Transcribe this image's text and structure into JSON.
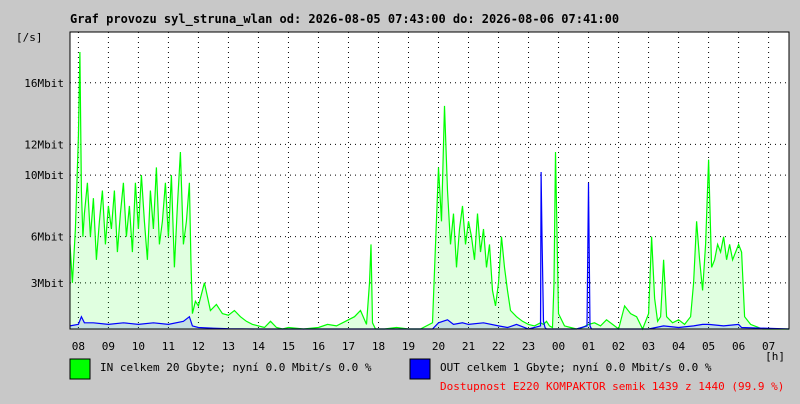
{
  "chart_data": {
    "type": "line",
    "title": "Graf provozu syl_struna_wlan od: 2026-08-05 07:43:00 do: 2026-08-06 07:41:00",
    "ylabel": "[/s]",
    "xlabel": "[h]",
    "grid": true,
    "ylim": [
      0,
      19.3
    ],
    "xlim": [
      7.72,
      31.68
    ],
    "y_ticks": [
      {
        "value": 3,
        "label": "3Mbit"
      },
      {
        "value": 6,
        "label": "6Mbit"
      },
      {
        "value": 10,
        "label": "10Mbit"
      },
      {
        "value": 12,
        "label": "12Mbit"
      },
      {
        "value": 16,
        "label": "16Mbit"
      }
    ],
    "x_ticks": [
      {
        "value": 8,
        "label": "08"
      },
      {
        "value": 9,
        "label": "09"
      },
      {
        "value": 10,
        "label": "10"
      },
      {
        "value": 11,
        "label": "11"
      },
      {
        "value": 12,
        "label": "12"
      },
      {
        "value": 13,
        "label": "13"
      },
      {
        "value": 14,
        "label": "14"
      },
      {
        "value": 15,
        "label": "15"
      },
      {
        "value": 16,
        "label": "16"
      },
      {
        "value": 17,
        "label": "17"
      },
      {
        "value": 18,
        "label": "18"
      },
      {
        "value": 19,
        "label": "19"
      },
      {
        "value": 20,
        "label": "20"
      },
      {
        "value": 21,
        "label": "21"
      },
      {
        "value": 22,
        "label": "22"
      },
      {
        "value": 23,
        "label": "23"
      },
      {
        "value": 24,
        "label": "00"
      },
      {
        "value": 25,
        "label": "01"
      },
      {
        "value": 26,
        "label": "02"
      },
      {
        "value": 27,
        "label": "03"
      },
      {
        "value": 28,
        "label": "04"
      },
      {
        "value": 29,
        "label": "05"
      },
      {
        "value": 30,
        "label": "06"
      },
      {
        "value": 31,
        "label": "07"
      }
    ],
    "series": [
      {
        "name": "IN",
        "color": "#00ff00",
        "fill": true,
        "x": [
          7.72,
          7.8,
          7.9,
          8.0,
          8.05,
          8.1,
          8.15,
          8.2,
          8.3,
          8.4,
          8.5,
          8.6,
          8.7,
          8.8,
          8.9,
          9.0,
          9.1,
          9.2,
          9.3,
          9.4,
          9.5,
          9.6,
          9.7,
          9.8,
          9.9,
          10.0,
          10.1,
          10.2,
          10.3,
          10.4,
          10.5,
          10.6,
          10.7,
          10.8,
          10.9,
          11.0,
          11.1,
          11.2,
          11.3,
          11.4,
          11.5,
          11.6,
          11.7,
          11.75,
          11.8,
          11.9,
          12.0,
          12.2,
          12.4,
          12.6,
          12.8,
          13.0,
          13.2,
          13.4,
          13.6,
          13.8,
          14.0,
          14.2,
          14.4,
          14.6,
          14.8,
          15.0,
          15.5,
          16.0,
          16.3,
          16.6,
          16.9,
          17.2,
          17.4,
          17.6,
          17.7,
          17.75,
          17.8,
          17.9,
          18.2,
          18.6,
          19.0,
          19.4,
          19.8,
          20.0,
          20.1,
          20.2,
          20.3,
          20.4,
          20.5,
          20.6,
          20.7,
          20.8,
          20.9,
          21.0,
          21.1,
          21.2,
          21.3,
          21.4,
          21.5,
          21.6,
          21.7,
          21.8,
          21.9,
          22.0,
          22.1,
          22.2,
          22.3,
          22.4,
          22.6,
          22.8,
          23.0,
          23.2,
          23.4,
          23.5,
          23.6,
          23.7,
          23.8,
          23.85,
          23.9,
          24.0,
          24.2,
          24.4,
          24.6,
          24.8,
          25.0,
          25.2,
          25.4,
          25.6,
          25.8,
          26.0,
          26.2,
          26.4,
          26.6,
          26.8,
          27.0,
          27.1,
          27.2,
          27.3,
          27.4,
          27.5,
          27.6,
          27.8,
          28.0,
          28.2,
          28.4,
          28.5,
          28.6,
          28.7,
          28.8,
          28.9,
          29.0,
          29.1,
          29.2,
          29.3,
          29.4,
          29.5,
          29.6,
          29.7,
          29.8,
          29.9,
          30.0,
          30.1,
          30.2,
          30.4,
          30.8,
          31.2,
          31.68
        ],
        "values": [
          5.5,
          3.0,
          6.5,
          12.5,
          18.0,
          9.0,
          6.0,
          7.5,
          9.5,
          6.0,
          8.5,
          4.5,
          7.0,
          9.0,
          5.5,
          8.0,
          6.5,
          9.0,
          5.0,
          7.5,
          9.5,
          6.0,
          8.0,
          5.0,
          9.5,
          6.5,
          10.0,
          7.0,
          4.5,
          9.0,
          6.5,
          10.5,
          5.5,
          7.0,
          9.5,
          6.0,
          10.0,
          4.0,
          8.0,
          11.5,
          5.5,
          7.0,
          9.5,
          4.5,
          1.0,
          1.8,
          1.5,
          3.0,
          1.2,
          1.6,
          1.0,
          0.9,
          1.2,
          0.8,
          0.5,
          0.3,
          0.2,
          0.1,
          0.5,
          0.1,
          0.0,
          0.1,
          0.0,
          0.1,
          0.3,
          0.2,
          0.5,
          0.8,
          1.2,
          0.3,
          3.0,
          5.5,
          0.4,
          0.0,
          0.0,
          0.1,
          0.0,
          0.0,
          0.4,
          10.5,
          7.0,
          14.5,
          9.0,
          5.5,
          7.5,
          4.0,
          6.5,
          8.0,
          5.5,
          7.0,
          6.0,
          4.5,
          7.5,
          5.0,
          6.5,
          4.0,
          5.5,
          2.5,
          1.5,
          3.0,
          6.0,
          4.0,
          2.5,
          1.2,
          0.8,
          0.5,
          0.3,
          0.2,
          0.4,
          0.3,
          0.5,
          0.2,
          0.1,
          3.0,
          11.5,
          1.0,
          0.2,
          0.1,
          0.0,
          0.1,
          0.3,
          0.4,
          0.2,
          0.6,
          0.3,
          0.0,
          1.5,
          1.0,
          0.8,
          0.0,
          1.0,
          6.0,
          2.0,
          0.5,
          0.8,
          4.5,
          0.8,
          0.4,
          0.6,
          0.3,
          0.8,
          3.0,
          7.0,
          4.5,
          2.5,
          5.5,
          11.0,
          4.0,
          4.5,
          5.5,
          5.0,
          6.0,
          4.5,
          5.5,
          4.5,
          5.0,
          5.5,
          5.0,
          0.8,
          0.3,
          0.0,
          0.0,
          0.0
        ]
      },
      {
        "name": "OUT",
        "color": "#0000ff",
        "fill": true,
        "x": [
          7.72,
          8.0,
          8.1,
          8.2,
          8.5,
          9.0,
          9.5,
          10.0,
          10.5,
          11.0,
          11.5,
          11.7,
          11.8,
          12.0,
          12.5,
          13.0,
          14.0,
          16.0,
          18.0,
          19.8,
          20.0,
          20.3,
          20.5,
          20.8,
          21.0,
          21.5,
          22.0,
          22.3,
          22.6,
          23.0,
          23.4,
          23.42,
          23.45,
          23.5,
          23.55,
          23.6,
          23.7,
          24.0,
          24.6,
          24.95,
          25.0,
          25.05,
          25.1,
          25.5,
          26.0,
          27.0,
          27.5,
          28.0,
          28.5,
          28.8,
          29.0,
          29.5,
          30.0,
          30.1,
          31.68
        ],
        "values": [
          0.2,
          0.3,
          0.8,
          0.4,
          0.4,
          0.3,
          0.4,
          0.3,
          0.4,
          0.3,
          0.5,
          0.8,
          0.2,
          0.1,
          0.05,
          0.02,
          0.0,
          0.0,
          0.0,
          0.0,
          0.4,
          0.6,
          0.3,
          0.4,
          0.3,
          0.4,
          0.2,
          0.1,
          0.3,
          0.0,
          0.2,
          10.2,
          6.0,
          0.5,
          0.1,
          0.0,
          0.0,
          0.0,
          0.0,
          0.2,
          9.5,
          0.2,
          0.0,
          0.0,
          0.0,
          0.0,
          0.2,
          0.1,
          0.2,
          0.3,
          0.3,
          0.2,
          0.3,
          0.1,
          0.0
        ]
      }
    ]
  },
  "legend": {
    "in_text": "IN celkem 20 Gbyte; nyní   0.0 Mbit/s 0.0 %",
    "in_color": "#00ff00",
    "out_text": "OUT celkem 1 Gbyte; nyní   0.0 Mbit/s 0.0 %",
    "out_color": "#0000ff"
  },
  "availability": {
    "text": "Dostupnost E220 KOMPAKTOR semik 1439 z 1440 (99.9 %)",
    "color": "#ff0000"
  }
}
